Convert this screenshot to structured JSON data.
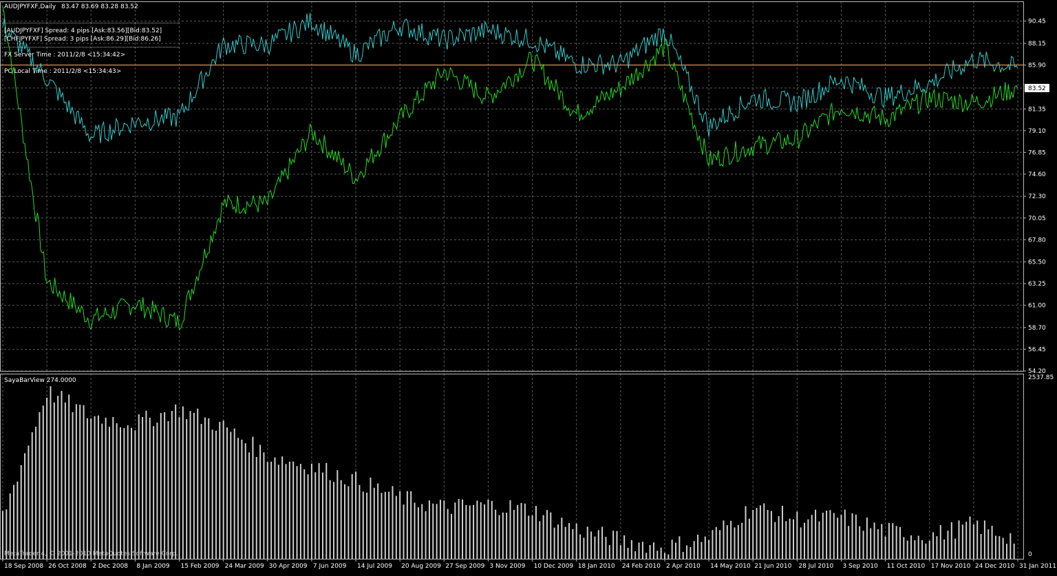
{
  "header": {
    "symbol_line": "AUDJPYFXF,Daily",
    "ohlc": "83.47 83.69 83.28 83.52",
    "spread_lines": [
      "[AUDJPYFXF] Spread: 4 pips [Ask:83.56][Bid:83.52]",
      "[CHFJPYFXF] Spread: 3 pips [Ask:86.29][Bid:86.26]"
    ],
    "server_time": "FX Server Time : 2011/2/8 <15:34:42>",
    "local_time": "PC Local Time : 2011/2/8 <15:34:43>"
  },
  "indicator": {
    "label": "SayaBarView 274.0000",
    "max_label": "2537.85",
    "min_label": "0"
  },
  "price_axis": {
    "ticks": [
      "90.45",
      "88.15",
      "85.90",
      "83.52",
      "81.35",
      "79.10",
      "76.85",
      "74.60",
      "72.30",
      "70.05",
      "67.80",
      "65.50",
      "63.25",
      "61.00",
      "58.70",
      "56.45",
      "54.20"
    ],
    "current_price": "83.52",
    "hline_price": 85.9
  },
  "time_axis": {
    "labels": [
      "18 Sep 2008",
      "26 Oct 2008",
      "2 Dec 2008",
      "8 Jan 2009",
      "15 Feb 2009",
      "24 Mar 2009",
      "30 Apr 2009",
      "7 Jun 2009",
      "14 Jul 2009",
      "20 Aug 2009",
      "27 Sep 2009",
      "3 Nov 2009",
      "10 Dec 2009",
      "18 Jan 2010",
      "24 Feb 2010",
      "2 Apr 2010",
      "14 May 2010",
      "21 Jun 2010",
      "28 Jul 2010",
      "3 Sep 2010",
      "11 Oct 2010",
      "17 Nov 2010",
      "24 Dec 2010",
      "31 Jan 2011"
    ]
  },
  "watermark": "MetaTrader 4, © 2001-2010 MetaQuotes Software Corp.",
  "colors": {
    "background": "#000000",
    "grid": "#5a5a5a",
    "audjpy": "#22dd22",
    "chfjpy": "#33cccc",
    "hline": "#c8823a",
    "bars": "#cfcfcf",
    "text": "#ffffff"
  },
  "chart_data": [
    {
      "type": "line",
      "title": "AUDJPYFXF,Daily",
      "x": [
        "18 Sep 2008",
        "26 Oct 2008",
        "2 Dec 2008",
        "8 Jan 2009",
        "15 Feb 2009",
        "24 Mar 2009",
        "30 Apr 2009",
        "7 Jun 2009",
        "14 Jul 2009",
        "20 Aug 2009",
        "27 Sep 2009",
        "3 Nov 2009",
        "10 Dec 2009",
        "18 Jan 2010",
        "24 Feb 2010",
        "2 Apr 2010",
        "14 May 2010",
        "21 Jun 2010",
        "28 Jul 2010",
        "3 Sep 2010",
        "11 Oct 2010",
        "17 Nov 2010",
        "24 Dec 2010",
        "31 Jan 2011"
      ],
      "series": [
        {
          "name": "AUDJPYFXF",
          "values": [
            92.0,
            63.5,
            59.5,
            61.2,
            59.2,
            71.5,
            71.5,
            79.0,
            74.2,
            80.3,
            85.3,
            82.5,
            86.5,
            80.8,
            83.5,
            87.8,
            76.0,
            77.5,
            78.2,
            81.6,
            80.3,
            82.5,
            82.0,
            83.52
          ]
        },
        {
          "name": "CHFJPYFXF",
          "values": [
            90.0,
            84.5,
            78.5,
            80.0,
            80.5,
            88.0,
            88.0,
            90.5,
            87.0,
            90.0,
            88.5,
            89.5,
            88.5,
            86.0,
            86.0,
            89.5,
            79.5,
            82.5,
            82.0,
            84.5,
            82.5,
            84.0,
            86.5,
            85.6
          ]
        }
      ],
      "ylim": [
        54.2,
        92.5
      ],
      "grid": true
    },
    {
      "type": "bar",
      "title": "SayaBarView 274.0000",
      "x": [
        "18 Sep 2008",
        "26 Oct 2008",
        "2 Dec 2008",
        "8 Jan 2009",
        "15 Feb 2009",
        "24 Mar 2009",
        "30 Apr 2009",
        "7 Jun 2009",
        "14 Jul 2009",
        "20 Aug 2009",
        "27 Sep 2009",
        "3 Nov 2009",
        "10 Dec 2009",
        "18 Jan 2010",
        "24 Feb 2010",
        "2 Apr 2010",
        "14 May 2010",
        "21 Jun 2010",
        "28 Jul 2010",
        "3 Sep 2010",
        "11 Oct 2010",
        "17 Nov 2010",
        "24 Dec 2010",
        "31 Jan 2011"
      ],
      "values": [
        600,
        2350,
        2000,
        1900,
        2100,
        1850,
        1450,
        1300,
        1100,
        860,
        720,
        760,
        690,
        420,
        260,
        160,
        300,
        720,
        560,
        590,
        400,
        320,
        480,
        274
      ],
      "ylim": [
        0,
        2537.85
      ]
    }
  ]
}
